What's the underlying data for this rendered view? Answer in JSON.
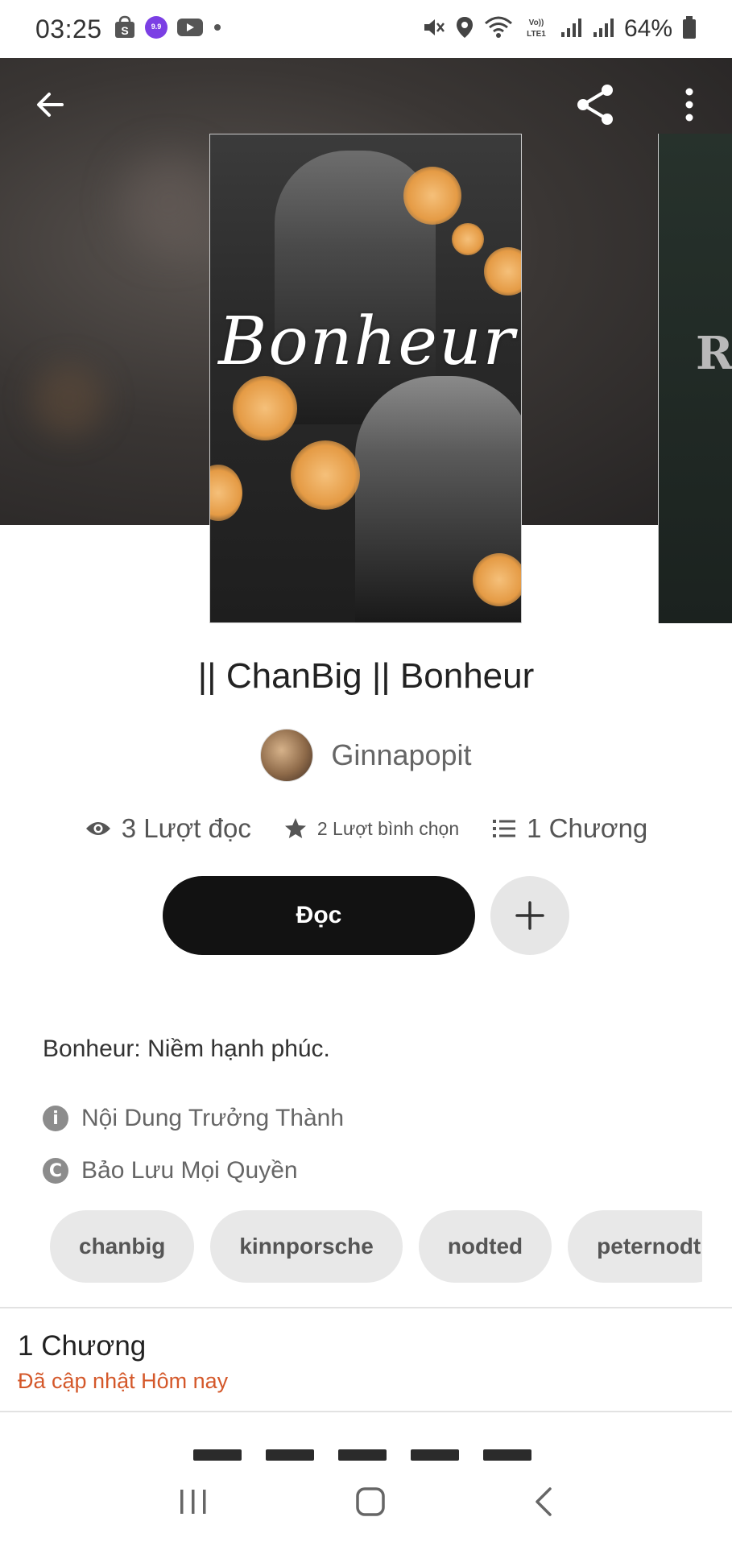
{
  "status_bar": {
    "time": "03:25",
    "battery": "64%",
    "icons_left": [
      "shopee-icon",
      "lazada-icon",
      "youtube-icon",
      "dot-icon"
    ],
    "icons_right": [
      "mute-icon",
      "location-icon",
      "wifi-icon",
      "volte-icon",
      "signal-icon",
      "signal-icon",
      "battery-icon"
    ]
  },
  "topbar": {
    "back_icon": "arrow-left-icon",
    "share_icon": "share-icon",
    "more_icon": "more-vertical-icon"
  },
  "cover": {
    "script_title": "Bonheur",
    "next_cover_letter": "R"
  },
  "story": {
    "title": "|| ChanBig ||  Bonheur",
    "author": "Ginnapopit",
    "stats": {
      "reads": "3 Lượt đọc",
      "votes": "2 Lượt bình chọn",
      "parts": "1 Chương"
    },
    "read_button": "Đọc",
    "description": "Bonheur: Niềm hạnh phúc.",
    "mature": "Nội Dung Trưởng Thành",
    "copyright": "Bảo Lưu Mọi Quyền",
    "tags": [
      "chanbig",
      "kinnporsche",
      "nodted",
      "peternodt"
    ],
    "chapter_count": "1 Chương",
    "updated": "Đã cập nhật Hôm nay"
  },
  "colors": {
    "accent_orange": "#d4582a",
    "button_dark": "#121212",
    "tag_bg": "#e8e8e8"
  }
}
